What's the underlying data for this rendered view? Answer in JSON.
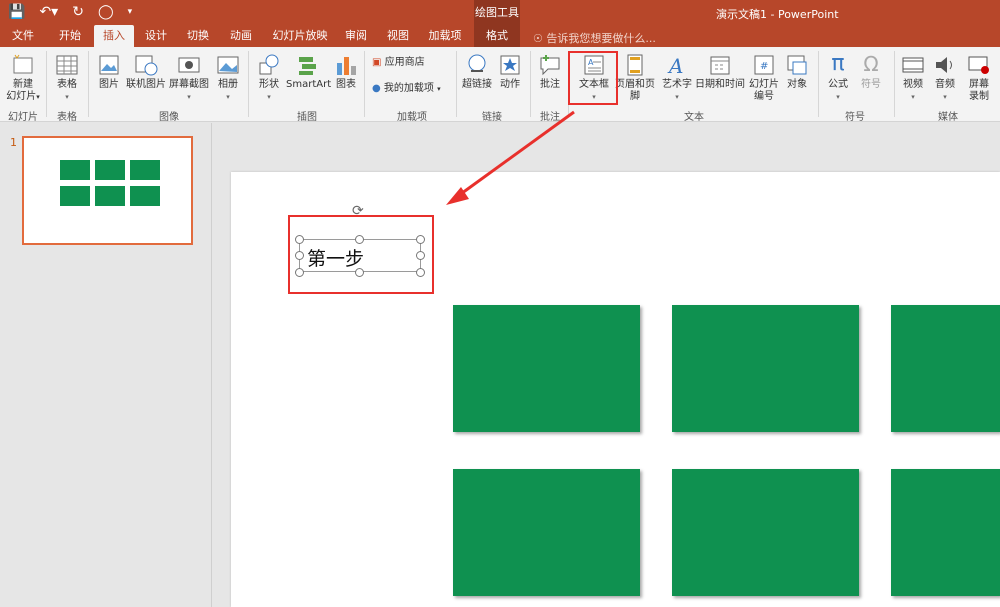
{
  "titlebar": {
    "context_group": "绘图工具",
    "document_title": "演示文稿1 - PowerPoint"
  },
  "tabs": [
    "文件",
    "开始",
    "插入",
    "设计",
    "切换",
    "动画",
    "幻灯片放映",
    "审阅",
    "视图",
    "加载项",
    "格式"
  ],
  "active_tab": "插入",
  "tellme": "告诉我您想要做什么...",
  "ribbon": {
    "slides": {
      "new_slide": "新建",
      "new_slide_2": "幻灯片",
      "group": "幻灯片"
    },
    "tables": {
      "table": "表格",
      "group": "表格"
    },
    "images": {
      "picture": "图片",
      "online_picture": "联机图片",
      "screenshot": "屏幕截图",
      "album": "相册",
      "group": "图像"
    },
    "illustrations": {
      "shapes": "形状",
      "smartart": "SmartArt",
      "chart": "图表",
      "group": "插图"
    },
    "addins": {
      "store": "应用商店",
      "my_addins": "我的加载项",
      "group": "加载项"
    },
    "links": {
      "hyperlink": "超链接",
      "action": "动作",
      "group": "链接"
    },
    "comments": {
      "comment": "批注",
      "group": "批注"
    },
    "text": {
      "textbox": "文本框",
      "header_footer": "页眉和页脚",
      "wordart": "艺术字",
      "datetime": "日期和时间",
      "slide_number": "幻灯片",
      "slide_number_2": "编号",
      "object": "对象",
      "group": "文本"
    },
    "symbols": {
      "equation": "公式",
      "symbol": "符号",
      "group": "符号"
    },
    "media": {
      "video": "视频",
      "audio": "音频",
      "screen_recording": "屏幕",
      "screen_recording_2": "录制",
      "group": "媒体"
    }
  },
  "slide_panel": {
    "slide_number": "1"
  },
  "slide": {
    "textbox_text": "第一步"
  },
  "colors": {
    "accent": "#b7472a",
    "green": "#0f9150",
    "annotation": "#e8302c"
  }
}
